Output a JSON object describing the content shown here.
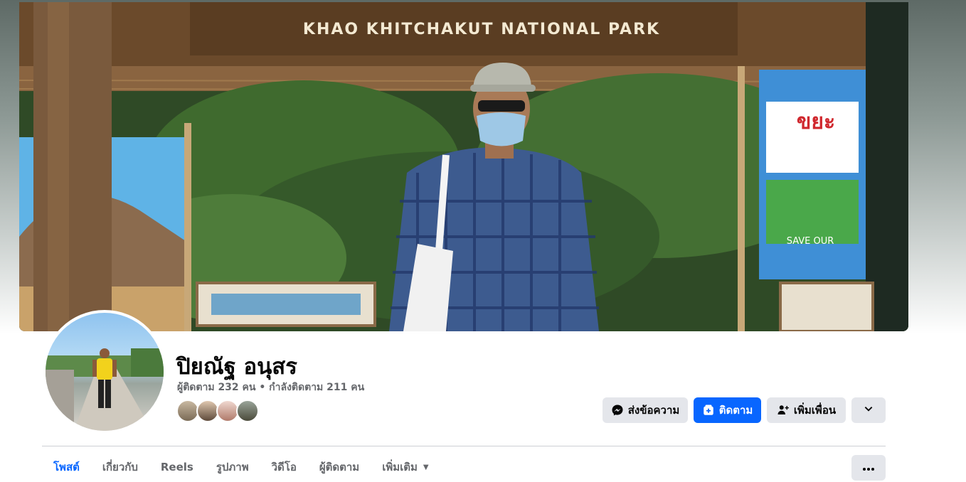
{
  "cover": {
    "sign_text": "KHAO KHITCHAKUT NATIONAL PARK"
  },
  "profile": {
    "name": "ปิยณัฐ อนุสร",
    "stats": "ผู้ติดตาม 232 คน • กำลังติดตาม 211 คน",
    "friend_avatars": [
      "friend-avatar-1",
      "friend-avatar-2",
      "friend-avatar-3",
      "friend-avatar-4"
    ]
  },
  "actions": {
    "message_label": "ส่งข้อความ",
    "follow_label": "ติดตาม",
    "add_friend_label": "เพิ่มเพื่อน"
  },
  "tabs": [
    {
      "label": "โพสต์",
      "active": true
    },
    {
      "label": "เกี่ยวกับ"
    },
    {
      "label": "Reels"
    },
    {
      "label": "รูปภาพ"
    },
    {
      "label": "วิดีโอ"
    },
    {
      "label": "ผู้ติดตาม"
    },
    {
      "label": "เพิ่มเติม"
    }
  ],
  "colors": {
    "primary_blue": "#0866ff",
    "button_gray": "#e4e6eb",
    "secondary_text": "#65676b"
  },
  "icons": [
    "messenger-icon",
    "follow-icon",
    "add-friend-icon",
    "chevron-down-icon",
    "more-dots-icon"
  ]
}
